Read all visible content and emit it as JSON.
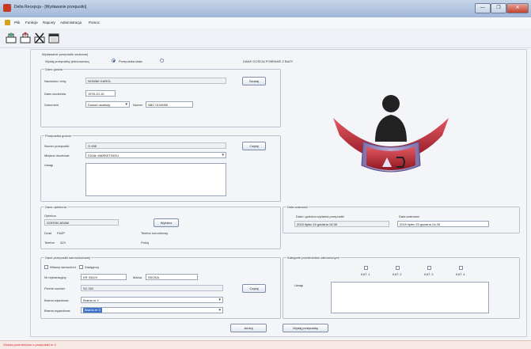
{
  "window": {
    "title": "Delta Recepcja - [Wydawanie przepustki]",
    "controls": [
      "—",
      "❐",
      "✕"
    ]
  },
  "menu": [
    "Plik",
    "Funkcje",
    "Raporty",
    "Administracja",
    "Pomoc"
  ],
  "toolbar": {
    "icons": [
      "sign-in-icon",
      "sign-out-icon",
      "delete-icon",
      "calendar-icon"
    ]
  },
  "main": {
    "section_title": "Wydawanie przepustki osobowej",
    "type_label": "Wydaj przepustkę jednorazową",
    "type_option2": "Przepustka stała",
    "db_note": "DANE GOŚCIA POBRANE Z BAZY",
    "guest": {
      "title": "Dane gościa",
      "name_label": "Nazwisko i imię",
      "name_value": "NOWAK KAROL",
      "search_btn": "Szukaj",
      "dob_label": "Data urodzenia",
      "dob_value": "1976-10-15",
      "doc_label": "Dokument",
      "doc_value": "Dowód osobisty",
      "num_label": "Numer",
      "num_value": "ABC 0104065"
    },
    "pass": {
      "title": "Przepustka gościa",
      "num_label": "Numer przepustki",
      "num_value": "G 008",
      "read_btn": "Czytaj",
      "place_label": "Miejsce docelowe",
      "place_value": "DZIAŁ MARKETINGU",
      "notes_label": "Uwagi"
    },
    "host": {
      "title": "Dane opiekuna",
      "carer_label": "Opiekun",
      "carer_value": "GORSKI ADAM",
      "choose_btn": "Wybierz",
      "dept_label": "Dział",
      "dept_value": "FAZP",
      "phone_label": "Telefon komórkowy",
      "tel_label": "Telefon",
      "tel_value": "423",
      "room_label": "Pokój"
    },
    "validity": {
      "title": "Data ważności",
      "issue_label": "Data i godzina wydania przepustki",
      "issue_value": "2015  lipiec   24  godzina  14:35",
      "expiry_label": "Data ważności",
      "expiry_value": "2015  lipiec   25  godzina  14:35"
    },
    "vehicle": {
      "title": "Dane przepustki samochodowej",
      "opt1": "Własny samochód",
      "opt2": "Zastępczy",
      "reg_label": "Nr rejestracyjny",
      "reg_value": "KR 3342V",
      "brand_label": "Marka",
      "brand_value": "SKODA",
      "permit_label": "Permit number",
      "permit_value": "SC 002",
      "read_btn": "Czytaj",
      "gate_in_label": "Brama wjazdowa",
      "gate_in_value": "Brama nr 2",
      "gate_out_label": "Brama wyjazdowa",
      "gate_out_value": "Brama nr 3"
    },
    "categories": {
      "title": "Kategorie przedmiotów zabronionych",
      "items": [
        "KAT. 1",
        "KAT. 2",
        "KAT. 3",
        "KAT. 4"
      ],
      "notes_label": "Uwagi"
    },
    "cancel_btn": "Anuluj",
    "issue_btn": "Wydaj przepustkę"
  },
  "status": {
    "text": "Gościa przeniesiono z przepustki nr 4"
  },
  "colors": {
    "accent_red": "#c8283a",
    "status_red": "#dd2222"
  }
}
